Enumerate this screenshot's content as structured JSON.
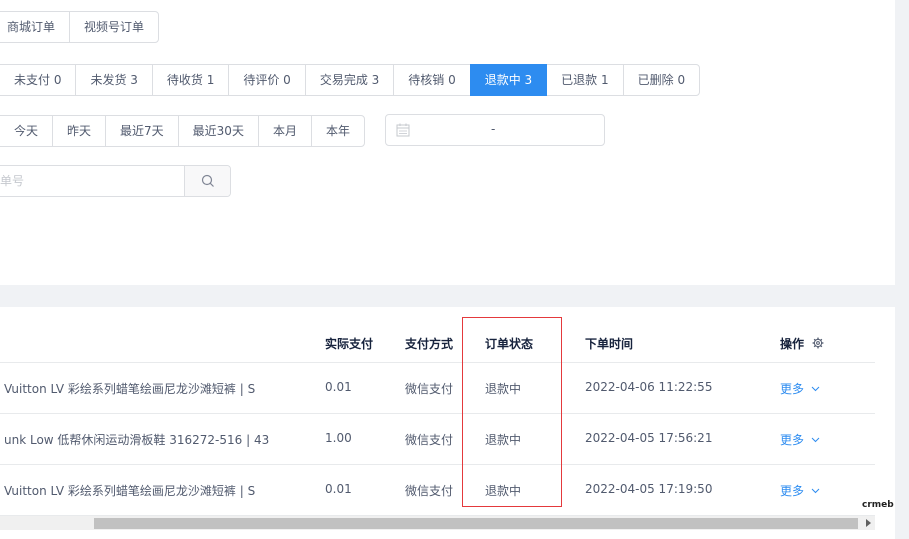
{
  "order_type_tabs": [
    {
      "label": "商城订单",
      "active": false
    },
    {
      "label": "视频号订单",
      "active": false
    }
  ],
  "status_tabs": [
    {
      "label": "未支付 0",
      "active": false
    },
    {
      "label": "未发货 3",
      "active": false
    },
    {
      "label": "待收货 1",
      "active": false
    },
    {
      "label": "待评价 0",
      "active": false
    },
    {
      "label": "交易完成 3",
      "active": false
    },
    {
      "label": "待核销 0",
      "active": false
    },
    {
      "label": "退款中 3",
      "active": true
    },
    {
      "label": "已退款 1",
      "active": false
    },
    {
      "label": "已删除 0",
      "active": false
    }
  ],
  "date_tabs": [
    {
      "label": "今天"
    },
    {
      "label": "昨天"
    },
    {
      "label": "最近7天"
    },
    {
      "label": "最近30天"
    },
    {
      "label": "本月"
    },
    {
      "label": "本年"
    }
  ],
  "date_range": {
    "separator": "-"
  },
  "search": {
    "placeholder": "单号",
    "value": ""
  },
  "table": {
    "headers": {
      "pay": "实际支付",
      "method": "支付方式",
      "status": "订单状态",
      "time": "下单时间",
      "op": "操作"
    },
    "rows": [
      {
        "name": "Vuitton LV 彩绘系列蜡笔绘画尼龙沙滩短裤 | S",
        "pay": "0.01",
        "method": "微信支付",
        "status": "退款中",
        "time": "2022-04-06 11:22:55",
        "op": "更多"
      },
      {
        "name": "unk Low 低帮休闲运动滑板鞋 316272-516 | 43",
        "pay": "1.00",
        "method": "微信支付",
        "status": "退款中",
        "time": "2022-04-05 17:56:21",
        "op": "更多"
      },
      {
        "name": "Vuitton LV 彩绘系列蜡笔绘画尼龙沙滩短裤 | S",
        "pay": "0.01",
        "method": "微信支付",
        "status": "退款中",
        "time": "2022-04-05 17:19:50",
        "op": "更多"
      }
    ]
  },
  "logo_text": "crmeb",
  "colors": {
    "accent": "#2d8cf0",
    "highlight": "#e4393c"
  }
}
